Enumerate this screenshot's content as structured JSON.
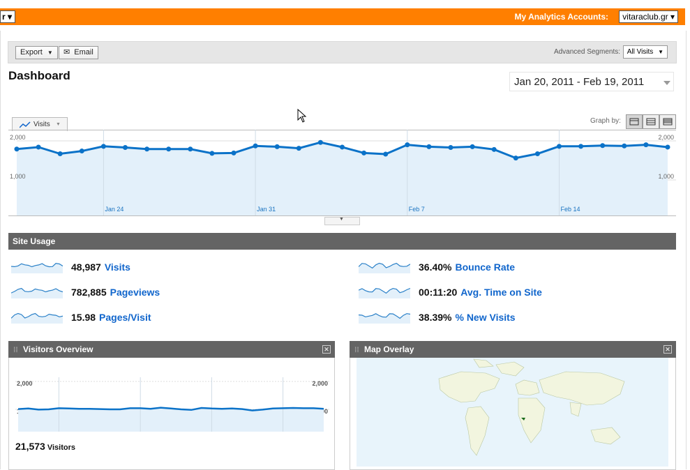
{
  "topbar": {
    "left_select": "r ▾",
    "accounts_label": "My Analytics Accounts:",
    "account_value": "vitaraclub.gr ▾"
  },
  "toolbar": {
    "export_label": "Export",
    "email_label": "Email",
    "advanced_label": "Advanced Segments:",
    "segment_value": "All Visits"
  },
  "page": {
    "title": "Dashboard",
    "date_range": "Jan 20, 2011 - Feb 19, 2011"
  },
  "graph": {
    "tab_label": "Visits",
    "graph_by_label": "Graph by:"
  },
  "site_usage": {
    "title": "Site Usage",
    "metrics": [
      {
        "value": "48,987",
        "label": "Visits"
      },
      {
        "value": "782,885",
        "label": "Pageviews"
      },
      {
        "value": "15.98",
        "label": "Pages/Visit"
      },
      {
        "value": "36.40%",
        "label": "Bounce Rate"
      },
      {
        "value": "00:11:20",
        "label": "Avg. Time on Site"
      },
      {
        "value": "38.39%",
        "label": "% New Visits"
      }
    ]
  },
  "visitors_overview": {
    "title": "Visitors Overview",
    "count": "21,573",
    "count_label": "Visitors"
  },
  "map_overlay": {
    "title": "Map Overlay"
  },
  "colors": {
    "accent": "#ff7f00",
    "line": "#0b72c8",
    "fill": "#e3f0fa",
    "link": "#1166cc"
  },
  "chart_data": [
    {
      "type": "line",
      "x": [
        "Jan 20",
        "Jan 21",
        "Jan 22",
        "Jan 23",
        "Jan 24",
        "Jan 25",
        "Jan 26",
        "Jan 27",
        "Jan 28",
        "Jan 29",
        "Jan 30",
        "Jan 31",
        "Feb 1",
        "Feb 2",
        "Feb 3",
        "Feb 4",
        "Feb 5",
        "Feb 6",
        "Feb 7",
        "Feb 8",
        "Feb 9",
        "Feb 10",
        "Feb 11",
        "Feb 12",
        "Feb 13",
        "Feb 14",
        "Feb 15",
        "Feb 16",
        "Feb 17",
        "Feb 18",
        "Feb 19"
      ],
      "series": [
        {
          "values": [
            1790,
            1840,
            1670,
            1740,
            1860,
            1830,
            1790,
            1790,
            1790,
            1680,
            1690,
            1870,
            1850,
            1810,
            1960,
            1840,
            1690,
            1660,
            1900,
            1850,
            1830,
            1850,
            1780,
            1560,
            1670,
            1860,
            1860,
            1880,
            1870,
            1900,
            1840
          ]
        }
      ],
      "ylim": [
        0,
        2000
      ],
      "yticks": [
        "1,000",
        "2,000"
      ],
      "xtick_labels": [
        "Jan 24",
        "Jan 31",
        "Feb 7",
        "Feb 14"
      ],
      "grid": true
    },
    {
      "type": "line",
      "series": [
        {
          "values": [
            1010,
            1030,
            990,
            1000,
            1040,
            1030,
            1020,
            1020,
            1010,
            1000,
            1000,
            1040,
            1040,
            1020,
            1060,
            1030,
            1000,
            980,
            1050,
            1030,
            1020,
            1030,
            1010,
            960,
            990,
            1030,
            1040,
            1050,
            1040,
            1040,
            1020
          ]
        }
      ],
      "ylim": [
        0,
        2000
      ],
      "yticks": [
        "1,000",
        "2,000"
      ],
      "grid": true
    }
  ]
}
